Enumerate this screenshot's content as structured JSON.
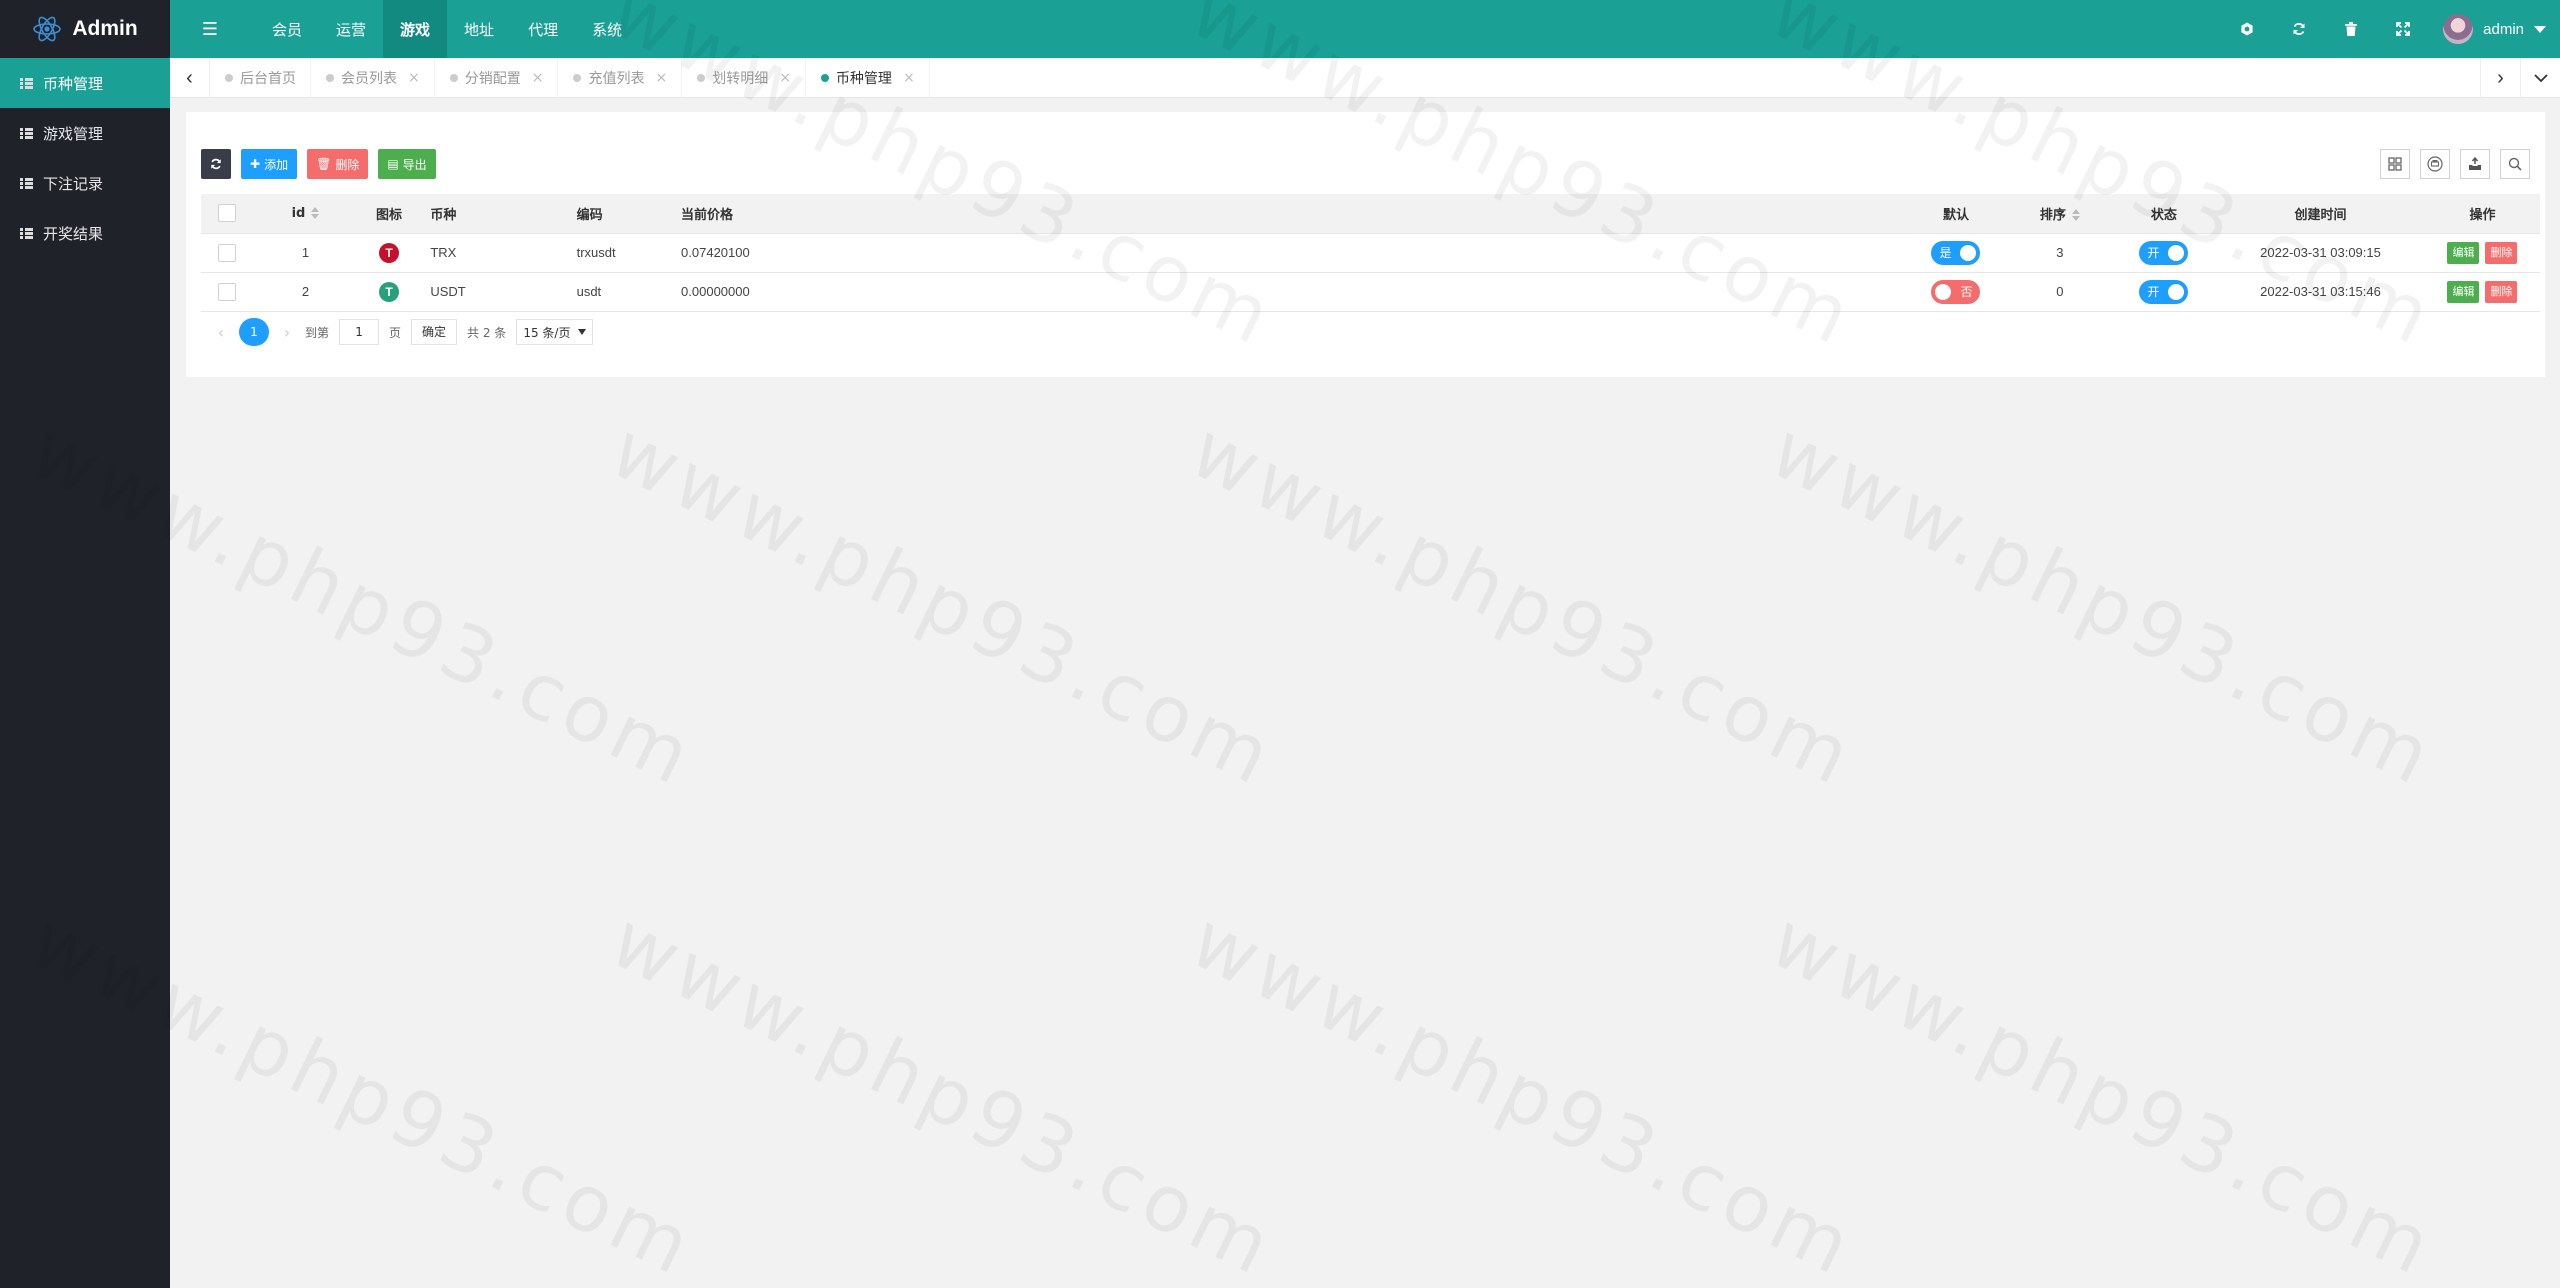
{
  "app": {
    "title": "Admin"
  },
  "nav": [
    {
      "label": "会员",
      "active": false
    },
    {
      "label": "运营",
      "active": false
    },
    {
      "label": "游戏",
      "active": true
    },
    {
      "label": "地址",
      "active": false
    },
    {
      "label": "代理",
      "active": false
    },
    {
      "label": "系统",
      "active": false
    }
  ],
  "header_tools": [
    "settings-icon",
    "refresh-icon",
    "trash-icon",
    "fullscreen-icon"
  ],
  "user": {
    "name": "admin"
  },
  "sidebar": {
    "items": [
      {
        "label": "币种管理",
        "active": true
      },
      {
        "label": "游戏管理",
        "active": false
      },
      {
        "label": "下注记录",
        "active": false
      },
      {
        "label": "开奖结果",
        "active": false
      }
    ]
  },
  "tabs": [
    {
      "label": "后台首页",
      "closable": false,
      "active": false
    },
    {
      "label": "会员列表",
      "closable": true,
      "active": false
    },
    {
      "label": "分销配置",
      "closable": true,
      "active": false
    },
    {
      "label": "充值列表",
      "closable": true,
      "active": false
    },
    {
      "label": "划转明细",
      "closable": true,
      "active": false
    },
    {
      "label": "币种管理",
      "closable": true,
      "active": true
    }
  ],
  "toolbar": {
    "add_label": "添加",
    "delete_label": "删除",
    "export_label": "导出"
  },
  "table": {
    "columns": [
      "id",
      "图标",
      "币种",
      "编码",
      "当前价格",
      "默认",
      "排序",
      "状态",
      "创建时间",
      "操作"
    ],
    "rows": [
      {
        "id": "1",
        "icon": "trx",
        "coin": "TRX",
        "code": "trxusdt",
        "price": "0.07420100",
        "default": "是",
        "default_on": true,
        "sort": "3",
        "status": "开",
        "status_on": true,
        "created": "2022-03-31 03:09:15"
      },
      {
        "id": "2",
        "icon": "usdt",
        "coin": "USDT",
        "code": "usdt",
        "price": "0.00000000",
        "default": "否",
        "default_on": false,
        "sort": "0",
        "status": "开",
        "status_on": true,
        "created": "2022-03-31 03:15:46"
      }
    ],
    "edit_label": "编辑",
    "delete_label": "删除"
  },
  "pager": {
    "current": "1",
    "goto_label": "到第",
    "goto_value": "1",
    "page_unit": "页",
    "confirm_label": "确定",
    "total": "共 2 条",
    "page_size": "15 条/页"
  },
  "watermark": "www.php93.com",
  "colors": {
    "primary": "#1aa094",
    "sidebar": "#20222a",
    "blue": "#1e9fff",
    "red": "#f56c6c",
    "green": "#4cae4c"
  }
}
